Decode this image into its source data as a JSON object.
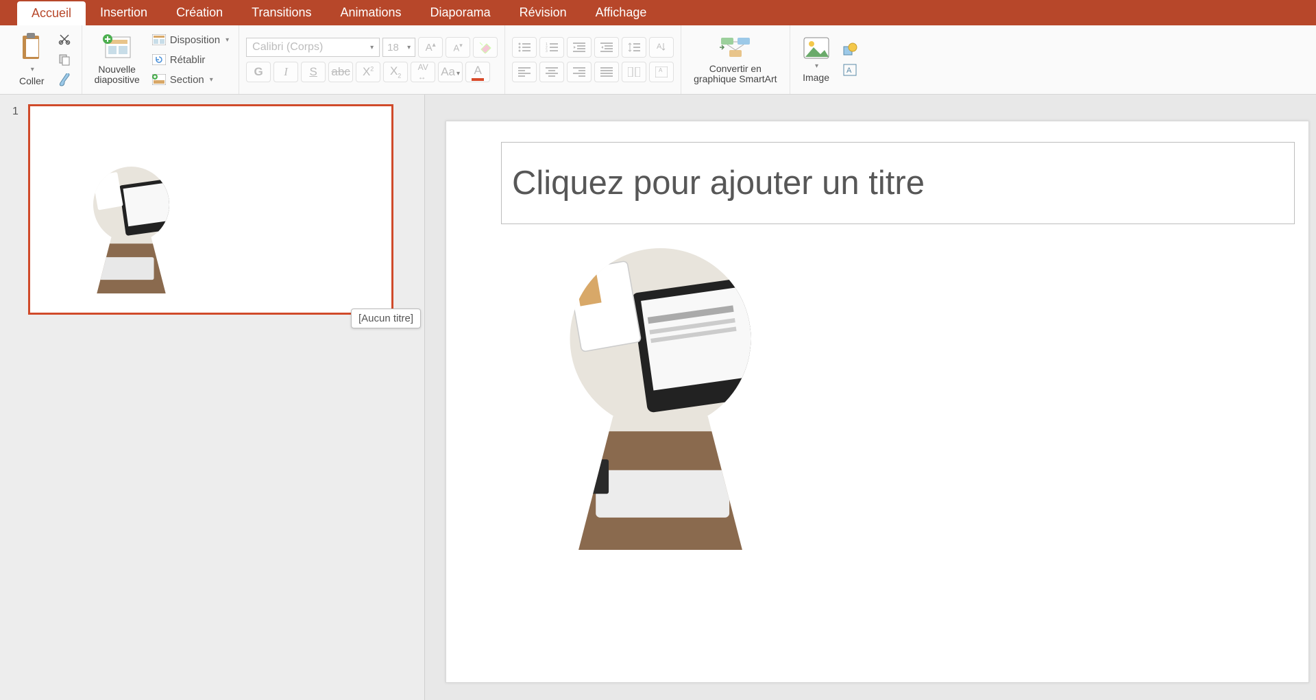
{
  "tabs": {
    "accueil": "Accueil",
    "insertion": "Insertion",
    "creation": "Création",
    "transitions": "Transitions",
    "animations": "Animations",
    "diaporama": "Diaporama",
    "revision": "Révision",
    "affichage": "Affichage"
  },
  "ribbon": {
    "coller": "Coller",
    "nouvelle_diapo": "Nouvelle\ndiapositive",
    "disposition": "Disposition",
    "retablir": "Rétablir",
    "section": "Section",
    "font_name": "Calibri (Corps)",
    "font_size": "18",
    "smartart": "Convertir en\ngraphique SmartArt",
    "image": "Image"
  },
  "thumb": {
    "number": "1",
    "tooltip": "[Aucun titre]"
  },
  "slide": {
    "title_placeholder": "Cliquez pour ajouter un titre"
  }
}
